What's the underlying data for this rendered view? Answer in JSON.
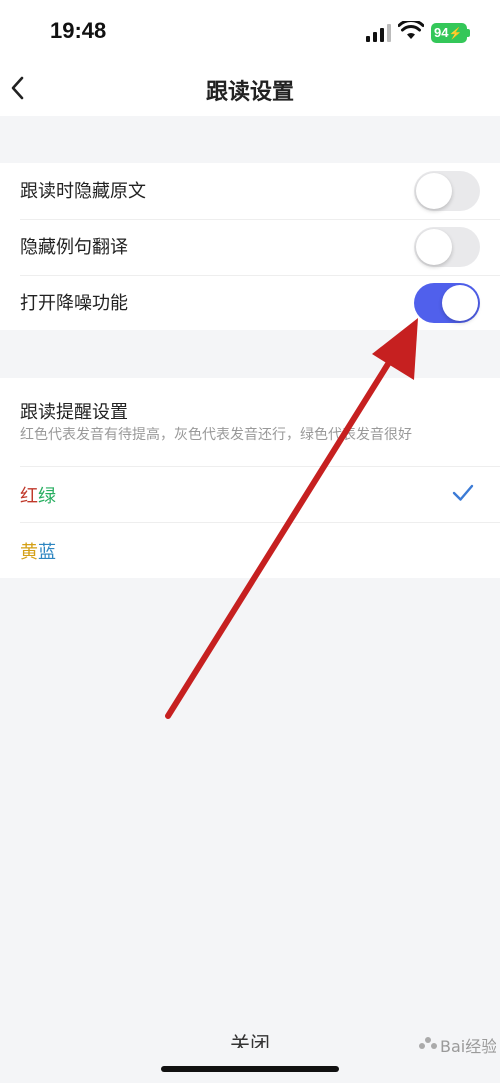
{
  "status_bar": {
    "time": "19:48",
    "battery": "94"
  },
  "header": {
    "title": "跟读设置",
    "back_icon": "chevron-left-icon"
  },
  "settings": {
    "toggles": [
      {
        "label": "跟读时隐藏原文",
        "on": false
      },
      {
        "label": "隐藏例句翻译",
        "on": false
      },
      {
        "label": "打开降噪功能",
        "on": true
      }
    ]
  },
  "reminder": {
    "title": "跟读提醒设置",
    "subtitle": "红色代表发音有待提高，灰色代表发音还行，绿色代表发音很好",
    "options": [
      {
        "part1": "红",
        "part2": "绿",
        "color1": "#c0392b",
        "color2": "#27ae60",
        "selected": true
      },
      {
        "part1": "黄",
        "part2": "蓝",
        "color1": "#d4a017",
        "color2": "#2e86c1",
        "selected": false
      }
    ]
  },
  "footer": {
    "close_label": "关闭"
  },
  "watermark": {
    "text": "Bai经验"
  },
  "colors": {
    "accent_toggle": "#5060ec",
    "check": "#3b7bd6",
    "annotation_arrow": "#c62020"
  }
}
